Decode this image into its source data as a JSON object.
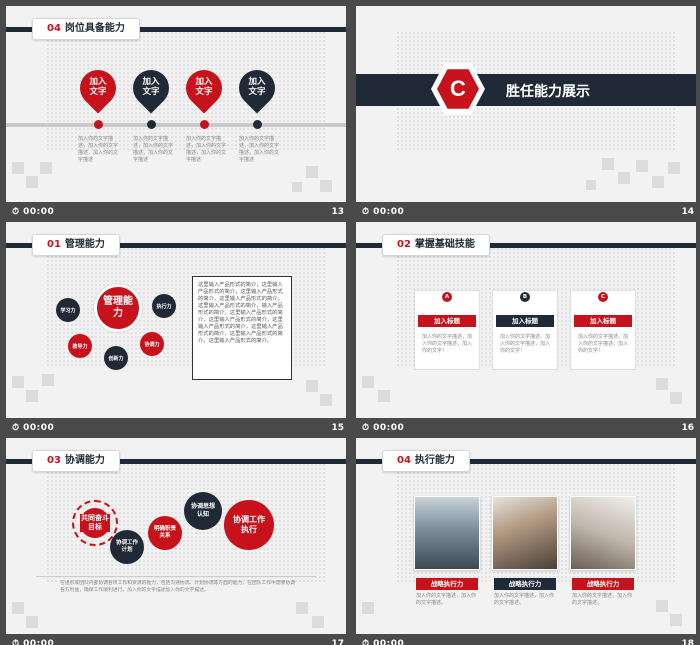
{
  "colors": {
    "red": "#c8121b",
    "navy": "#1f2a36",
    "bg": "#f2f2f2",
    "footer": "#4a4a4a"
  },
  "footer_time": "00:00",
  "slides": {
    "s13": {
      "num": "04",
      "title": "岗位具备能力",
      "page": "13",
      "pins": [
        {
          "label": "加入文字"
        },
        {
          "label": "加入文字"
        },
        {
          "label": "加入文字"
        },
        {
          "label": "加入文字"
        }
      ],
      "texts": [
        "加入你的文字描述，加入你的文字描述，加入你的文字描述",
        "加入你的文字描述，加入你的文字描述，加入你的文字描述",
        "加入你的文字描述，加入你的文字描述，加入你的文字描述",
        "加入你的文字描述，加入你的文字描述，加入你的文字描述"
      ]
    },
    "s14": {
      "letter": "C",
      "title": "胜任能力展示",
      "page": "14"
    },
    "s15": {
      "num": "01",
      "title": "管理能力",
      "page": "15",
      "center": "管理能力",
      "bubbles": [
        "学习力",
        "执行力",
        "教导力",
        "协调力",
        "创新力"
      ],
      "paragraph": "这里输入产品形式的简介，这里输入产品形式的简介，这里输入产品形式的简介，这里输入产品形式的简介，这里输入产品形式的简介，输入产品形式的简介，这里输入产品形式的简介，这里输入产品形式的简介，这里输入产品形式的简介，这里输入产品形式的简介，这里输入产品形式的简介，这里输入产品形式的简介。"
    },
    "s16": {
      "num": "02",
      "title": "掌握基础技能",
      "page": "16",
      "cards": [
        {
          "badge": "A",
          "label": "加入标题",
          "text": "加入你的文字描述，加入你的文字描述，加入你的文字！"
        },
        {
          "badge": "B",
          "label": "加入标题",
          "text": "加入你的文字描述，加入你的文字描述，加入你的文字！"
        },
        {
          "badge": "C",
          "label": "加入标题",
          "text": "加入你的文字描述，加入你的文字描述，加入你的文字！"
        }
      ]
    },
    "s17": {
      "num": "03",
      "title": "协调能力",
      "page": "17",
      "gears": [
        "共同奋斗目标",
        "协调工作计划",
        "明确职责关系",
        "协调思想认知",
        "协调工作执行"
      ],
      "paragraph": "在组织或团队内部协调各项工作和资源的能力，包括沟通协调、计划协调等方面的能力，在团队工作中需要协调各方利益，确保工作顺利进行。加入你的文字描述加入你的文字描述。"
    },
    "s18": {
      "num": "04",
      "title": "执行能力",
      "page": "18",
      "items": [
        {
          "label": "战略执行力",
          "text": "加入你的文字描述，加入你的文字描述。"
        },
        {
          "label": "战略执行力",
          "text": "加入你的文字描述，加入你的文字描述。"
        },
        {
          "label": "战略执行力",
          "text": "加入你的文字描述，加入你的文字描述。"
        }
      ]
    }
  }
}
